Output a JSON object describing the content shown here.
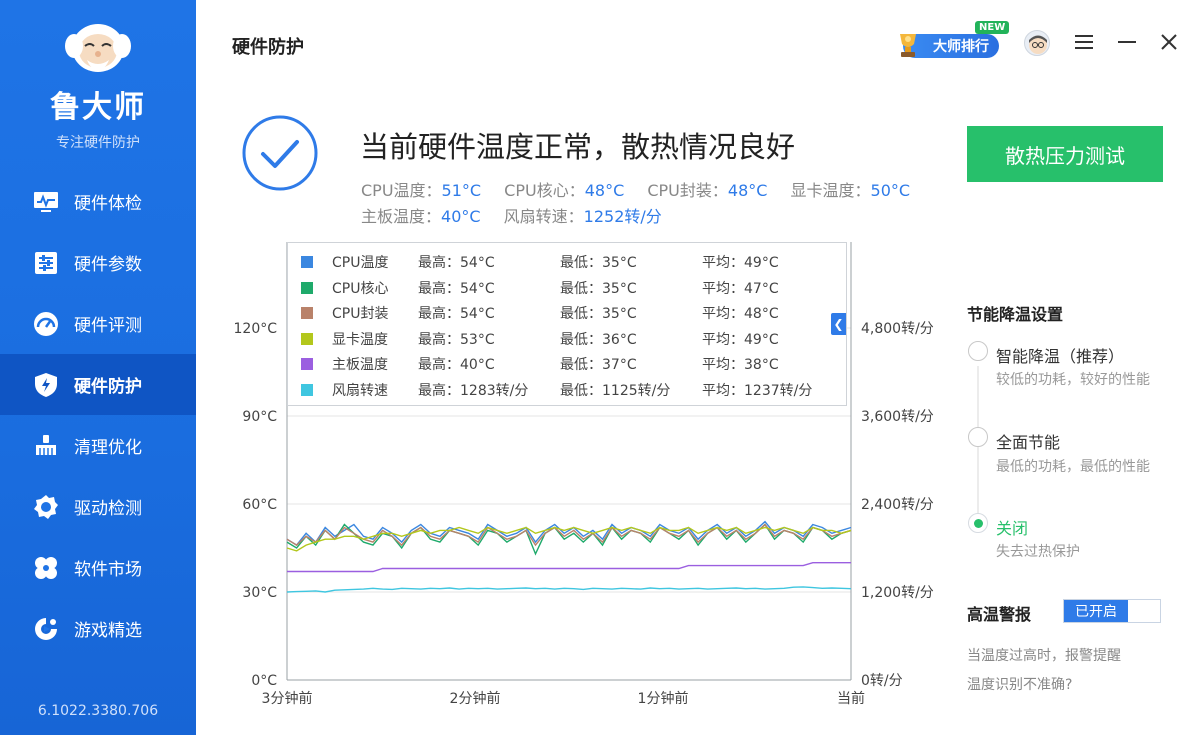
{
  "app": {
    "name": "鲁大师",
    "subtitle": "专注硬件防护",
    "version": "6.1022.3380.706"
  },
  "sidebar": {
    "items": [
      {
        "label": "硬件体检",
        "icon": "monitor-icon"
      },
      {
        "label": "硬件参数",
        "icon": "parameters-icon"
      },
      {
        "label": "硬件评测",
        "icon": "gauge-icon"
      },
      {
        "label": "硬件防护",
        "icon": "shield-bolt-icon",
        "active": true
      },
      {
        "label": "清理优化",
        "icon": "broom-icon"
      },
      {
        "label": "驱动检测",
        "icon": "gear-icon"
      },
      {
        "label": "软件市场",
        "icon": "clover-icon"
      },
      {
        "label": "游戏精选",
        "icon": "gamepad-icon"
      }
    ]
  },
  "header": {
    "title": "硬件防护",
    "rank_label": "大师排行",
    "new_badge": "NEW"
  },
  "status": {
    "headline": "当前硬件温度正常，散热情况良好",
    "readings_row1": [
      {
        "label": "CPU温度：",
        "value": "51°C"
      },
      {
        "label": "CPU核心：",
        "value": "48°C"
      },
      {
        "label": "CPU封装：",
        "value": "48°C"
      },
      {
        "label": "显卡温度：",
        "value": "50°C"
      }
    ],
    "readings_row2": [
      {
        "label": "主板温度：",
        "value": "40°C"
      },
      {
        "label": "风扇转速：",
        "value": "1252转/分"
      }
    ],
    "stress_button": "散热压力测试"
  },
  "legend": [
    {
      "name": "CPU温度",
      "max": "最高：54°C",
      "min": "最低：35°C",
      "avg": "平均：49°C",
      "color": "#3b87e0"
    },
    {
      "name": "CPU核心",
      "max": "最高：54°C",
      "min": "最低：35°C",
      "avg": "平均：47°C",
      "color": "#1faa6b"
    },
    {
      "name": "CPU封装",
      "max": "最高：54°C",
      "min": "最低：35°C",
      "avg": "平均：48°C",
      "color": "#b9826a"
    },
    {
      "name": "显卡温度",
      "max": "最高：53°C",
      "min": "最低：36°C",
      "avg": "平均：49°C",
      "color": "#b3c71c"
    },
    {
      "name": "主板温度",
      "max": "最高：40°C",
      "min": "最低：37°C",
      "avg": "平均：38°C",
      "color": "#9b5fe0"
    },
    {
      "name": "风扇转速",
      "max": "最高：1283转/分",
      "min": "最低：1125转/分",
      "avg": "平均：1237转/分",
      "color": "#3fc6e0"
    }
  ],
  "chart_data": {
    "type": "line",
    "x_tick_labels": [
      "3分钟前",
      "2分钟前",
      "1分钟前",
      "当前"
    ],
    "y_left_ticks": [
      "0°C",
      "30°C",
      "60°C",
      "90°C",
      "120°C"
    ],
    "y_right_ticks": [
      "0转/分",
      "1,200转/分",
      "2,400转/分",
      "3,600转/分",
      "4,800转/分"
    ],
    "ylim_left": [
      0,
      120
    ],
    "ylim_right": [
      0,
      4800
    ],
    "series": [
      {
        "name": "CPU温度",
        "axis": "left",
        "values": [
          48,
          46,
          50,
          47,
          52,
          49,
          51,
          53,
          49,
          48,
          52,
          50,
          47,
          51,
          53,
          50,
          49,
          52,
          51,
          50,
          48,
          53,
          51,
          49,
          50,
          52,
          47,
          51,
          53,
          50,
          52,
          49,
          51,
          48,
          53,
          50,
          52,
          51,
          49,
          53,
          51,
          50,
          52,
          48,
          51,
          53,
          50,
          52,
          49,
          51,
          54,
          50,
          52,
          51,
          49,
          53,
          52,
          50,
          51,
          52
        ]
      },
      {
        "name": "CPU核心",
        "axis": "left",
        "values": [
          47,
          45,
          49,
          46,
          51,
          48,
          53,
          50,
          47,
          46,
          50,
          49,
          45,
          50,
          52,
          48,
          47,
          51,
          50,
          49,
          46,
          51,
          50,
          47,
          49,
          51,
          43,
          50,
          52,
          48,
          50,
          47,
          50,
          46,
          52,
          48,
          51,
          50,
          47,
          52,
          50,
          48,
          51,
          46,
          50,
          52,
          48,
          51,
          47,
          50,
          53,
          48,
          51,
          50,
          47,
          52,
          51,
          48,
          50,
          51
        ]
      },
      {
        "name": "CPU封装",
        "axis": "left",
        "values": [
          48,
          46,
          49,
          47,
          51,
          48,
          52,
          50,
          48,
          47,
          51,
          49,
          46,
          50,
          52,
          49,
          48,
          51,
          50,
          49,
          47,
          52,
          50,
          48,
          49,
          51,
          46,
          50,
          52,
          49,
          51,
          48,
          50,
          47,
          52,
          49,
          51,
          50,
          48,
          52,
          50,
          49,
          51,
          47,
          50,
          52,
          49,
          51,
          48,
          50,
          53,
          49,
          51,
          50,
          48,
          52,
          51,
          49,
          50,
          51
        ]
      },
      {
        "name": "显卡温度",
        "axis": "left",
        "values": [
          45,
          44,
          46,
          47,
          48,
          48,
          49,
          49,
          48,
          49,
          50,
          50,
          49,
          50,
          51,
          50,
          51,
          51,
          52,
          51,
          50,
          52,
          51,
          50,
          51,
          52,
          50,
          51,
          52,
          51,
          52,
          51,
          50,
          51,
          52,
          51,
          52,
          51,
          50,
          52,
          51,
          51,
          52,
          50,
          51,
          52,
          51,
          52,
          50,
          51,
          52,
          51,
          52,
          51,
          50,
          52,
          51,
          51,
          50,
          51
        ]
      },
      {
        "name": "主板温度",
        "axis": "left",
        "values": [
          37,
          37,
          37,
          37,
          37,
          37,
          37,
          37,
          37,
          37,
          38,
          38,
          38,
          38,
          38,
          38,
          38,
          38,
          38,
          38,
          38,
          38,
          38,
          38,
          38,
          38,
          38,
          38,
          38,
          38,
          38,
          38,
          38,
          38,
          38,
          38,
          38,
          38,
          38,
          38,
          38,
          38,
          39,
          39,
          39,
          39,
          39,
          39,
          39,
          39,
          39,
          39,
          39,
          39,
          39,
          40,
          40,
          40,
          40,
          40
        ]
      },
      {
        "name": "风扇转速",
        "axis": "right",
        "values": [
          1200,
          1205,
          1210,
          1215,
          1200,
          1225,
          1230,
          1235,
          1240,
          1250,
          1240,
          1235,
          1250,
          1245,
          1240,
          1250,
          1245,
          1255,
          1240,
          1250,
          1245,
          1250,
          1240,
          1245,
          1250,
          1255,
          1245,
          1250,
          1240,
          1250,
          1245,
          1235,
          1250,
          1245,
          1240,
          1250,
          1245,
          1240,
          1255,
          1245,
          1250,
          1240,
          1245,
          1250,
          1240,
          1245,
          1250,
          1255,
          1245,
          1250,
          1240,
          1245,
          1250,
          1265,
          1270,
          1260,
          1250,
          1255,
          1250,
          1245
        ]
      }
    ]
  },
  "right_panel": {
    "energy_title": "节能降温设置",
    "options": [
      {
        "label": "智能降温（推荐）",
        "desc": "较低的功耗，较好的性能",
        "checked": false
      },
      {
        "label": "全面节能",
        "desc": "最低的功耗，最低的性能",
        "checked": false
      },
      {
        "label": "关闭",
        "desc": "失去过热保护",
        "checked": true
      }
    ],
    "alarm_title": "高温警报",
    "alarm_toggle": "已开启",
    "alarm_note": "当温度过高时，报警提醒",
    "alarm_link": "温度识别不准确?"
  },
  "colors": {
    "sidebar": "#1f74e6",
    "sidebar_active": "#0f55c4",
    "accent": "#2f7be8",
    "green": "#27c06b"
  }
}
